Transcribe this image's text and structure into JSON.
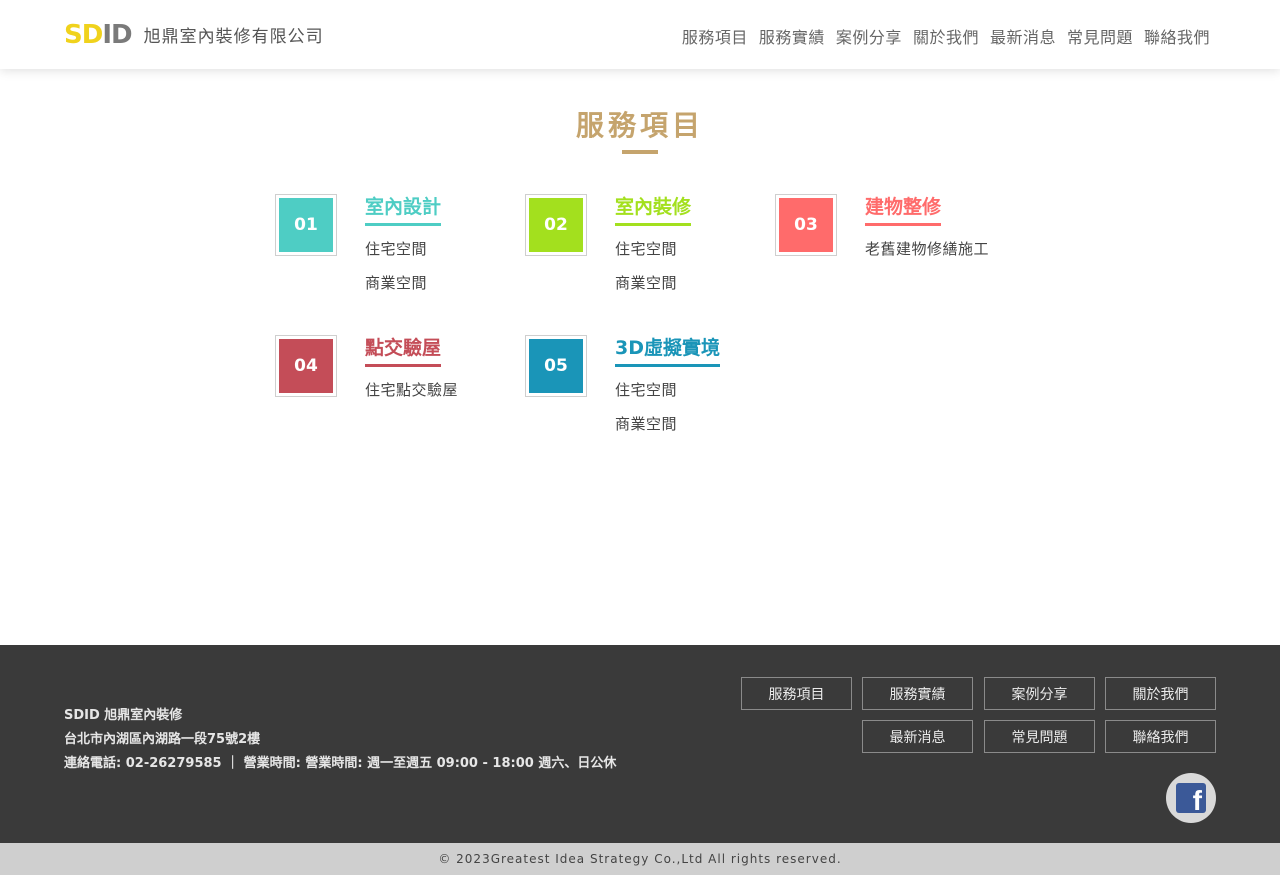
{
  "header": {
    "logo_sd": "SD",
    "logo_id": "ID",
    "company_name": "旭鼎室內裝修有限公司",
    "nav": [
      "服務項目",
      "服務實績",
      "案例分享",
      "關於我們",
      "最新消息",
      "常見問題",
      "聯絡我們"
    ]
  },
  "main": {
    "title": "服務項目",
    "accent_color": "#c5a46d",
    "services": [
      {
        "num": "01",
        "title": "室內設計",
        "color": "#4ecdc4",
        "items": [
          "住宅空間",
          "商業空間"
        ]
      },
      {
        "num": "02",
        "title": "室內裝修",
        "color": "#a3e01e",
        "items": [
          "住宅空間",
          "商業空間"
        ]
      },
      {
        "num": "03",
        "title": "建物整修",
        "color": "#ff6b6b",
        "items": [
          "老舊建物修繕施工"
        ]
      },
      {
        "num": "04",
        "title": "點交驗屋",
        "color": "#c44d58",
        "items": [
          "住宅點交驗屋"
        ]
      },
      {
        "num": "05",
        "title": "3D虛擬實境",
        "color": "#1a95b8",
        "items": [
          "住宅空間",
          "商業空間"
        ]
      }
    ]
  },
  "footer": {
    "company": "SDID 旭鼎室內裝修",
    "address": "台北市內湖區內湖路一段75號2樓",
    "contact": "連絡電話: 02-26279585 ｜ 營業時間: 營業時間: 週一至週五 09:00 - 18:00 週六、日公休",
    "buttons": [
      "服務項目",
      "服務實績",
      "案例分享",
      "關於我們",
      "最新消息",
      "常見問題",
      "聯絡我們"
    ],
    "facebook_icon": "facebook-icon",
    "copyright": "© 2023Greatest Idea Strategy Co.,Ltd All rights reserved."
  }
}
